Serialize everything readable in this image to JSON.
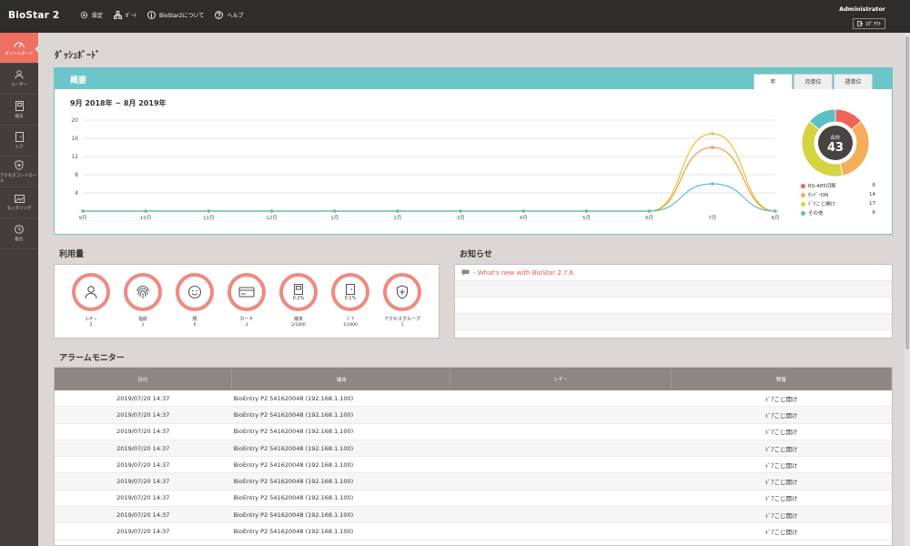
{
  "app": {
    "brand": "BioStar 2"
  },
  "topnav": [
    {
      "label": "設定",
      "icon": "gear-icon"
    },
    {
      "label": "ﾎﾟｰﾄ",
      "icon": "network-icon"
    },
    {
      "label": "BioStar2について",
      "icon": "info-icon"
    },
    {
      "label": "ヘルプ",
      "icon": "help-icon"
    }
  ],
  "user": {
    "name": "Administrator",
    "logout": "ﾛｸﾞｱｳﾄ"
  },
  "sidebar": [
    {
      "label": "ダッシュボード",
      "icon": "dashboard-icon",
      "active": true
    },
    {
      "label": "ユーザー",
      "icon": "user-icon"
    },
    {
      "label": "端末",
      "icon": "device-icon"
    },
    {
      "label": "ドア",
      "icon": "door-icon"
    },
    {
      "label": "アクセスコントロール",
      "icon": "access-control-icon"
    },
    {
      "label": "モニタリング",
      "icon": "monitoring-icon"
    },
    {
      "label": "勤怠",
      "icon": "time-attendance-icon"
    }
  ],
  "page": {
    "title": "ﾀﾞｯｼｭﾎﾞｰﾄﾞ"
  },
  "overview": {
    "title": "概要",
    "tabs": [
      {
        "label": "年",
        "active": true
      },
      {
        "label": "月単位"
      },
      {
        "label": "週単位"
      }
    ],
    "date_range": "9月 2018年 ~ 8月 2019年"
  },
  "chart_data": {
    "type": "line",
    "x": [
      "9月",
      "10月",
      "11月",
      "12月",
      "1月",
      "2月",
      "3月",
      "4月",
      "5月",
      "6月",
      "7月",
      "8月"
    ],
    "ylim": [
      0,
      20
    ],
    "yticks": [
      4,
      8,
      12,
      16,
      20
    ],
    "grid": true,
    "series": [
      {
        "name": "ﾀﾝﾊﾟｰON",
        "color": "#e0c832",
        "values": [
          0,
          0,
          0,
          0,
          0,
          0,
          0,
          0,
          0,
          0,
          17,
          0
        ]
      },
      {
        "name": "ﾄﾞｱこじ開け",
        "color": "#f09a55",
        "values": [
          0,
          0,
          0,
          0,
          0,
          0,
          0,
          0,
          0,
          0,
          14,
          0
        ]
      },
      {
        "name": "その他",
        "color": "#5bbfc6",
        "values": [
          0,
          0,
          0,
          0,
          0,
          0,
          0,
          0,
          0,
          0,
          6,
          0
        ]
      }
    ],
    "donut": {
      "total_label": "合計",
      "total": "43",
      "slices": [
        {
          "name": "RS-485切断",
          "value": 6,
          "color": "#ef6457"
        },
        {
          "name": "ﾀﾝﾊﾟｰON",
          "value": 14,
          "color": "#f4ad5a"
        },
        {
          "name": "ﾄﾞｱこじ開け",
          "value": 17,
          "color": "#d4d443"
        },
        {
          "name": "その他",
          "value": 6,
          "color": "#5bbfc6"
        }
      ]
    }
  },
  "usage": {
    "title": "利用量",
    "items": [
      {
        "label": "ﾕｰｻﾞｰ",
        "value": "2",
        "icon": "user-icon",
        "pct": ""
      },
      {
        "label": "指紋",
        "value": "1",
        "icon": "fingerprint-icon",
        "pct": ""
      },
      {
        "label": "顔",
        "value": "0",
        "icon": "face-icon",
        "pct": ""
      },
      {
        "label": "カード",
        "value": "3",
        "icon": "card-icon",
        "pct": ""
      },
      {
        "label": "端末",
        "value": "2/1000",
        "icon": "device-icon",
        "pct": "0.2%"
      },
      {
        "label": "ﾄﾞｱ",
        "value": "1/1000",
        "icon": "door-icon",
        "pct": "0.1%"
      },
      {
        "label": "アクセスグループ",
        "value": "1",
        "icon": "access-group-icon",
        "pct": ""
      }
    ]
  },
  "news": {
    "title": "お知らせ",
    "items": [
      {
        "text": "- What's new with BioStar 2.7.6"
      },
      {
        "text": ""
      },
      {
        "text": ""
      },
      {
        "text": ""
      }
    ]
  },
  "alarm": {
    "title": "アラームモニター",
    "headers": {
      "date": "日付",
      "device": "端末",
      "user": "ﾕｰｻﾞｰ",
      "alarm": "警報"
    },
    "rows": [
      {
        "date": "2019/07/20 14:37",
        "device": "BioEntry P2 541620048 (192.168.1.100)",
        "user": "",
        "alarm": "ﾄﾞｱこじ開け"
      },
      {
        "date": "2019/07/20 14:37",
        "device": "BioEntry P2 541620048 (192.168.1.100)",
        "user": "",
        "alarm": "ﾄﾞｱこじ開け"
      },
      {
        "date": "2019/07/20 14:37",
        "device": "BioEntry P2 541620048 (192.168.1.100)",
        "user": "",
        "alarm": "ﾄﾞｱこじ開け"
      },
      {
        "date": "2019/07/20 14:37",
        "device": "BioEntry P2 541620048 (192.168.1.100)",
        "user": "",
        "alarm": "ﾄﾞｱこじ開け"
      },
      {
        "date": "2019/07/20 14:37",
        "device": "BioEntry P2 541620048 (192.168.1.100)",
        "user": "",
        "alarm": "ﾄﾞｱこじ開け"
      },
      {
        "date": "2019/07/20 14:37",
        "device": "BioEntry P2 541620048 (192.168.1.100)",
        "user": "",
        "alarm": "ﾄﾞｱこじ開け"
      },
      {
        "date": "2019/07/20 14:37",
        "device": "BioEntry P2 541620048 (192.168.1.100)",
        "user": "",
        "alarm": "ﾄﾞｱこじ開け"
      },
      {
        "date": "2019/07/20 14:37",
        "device": "BioEntry P2 541620048 (192.168.1.100)",
        "user": "",
        "alarm": "ﾄﾞｱこじ開け"
      },
      {
        "date": "2019/07/20 14:37",
        "device": "BioEntry P2 541620048 (192.168.1.100)",
        "user": "",
        "alarm": "ﾄﾞｱこじ開け"
      }
    ]
  }
}
